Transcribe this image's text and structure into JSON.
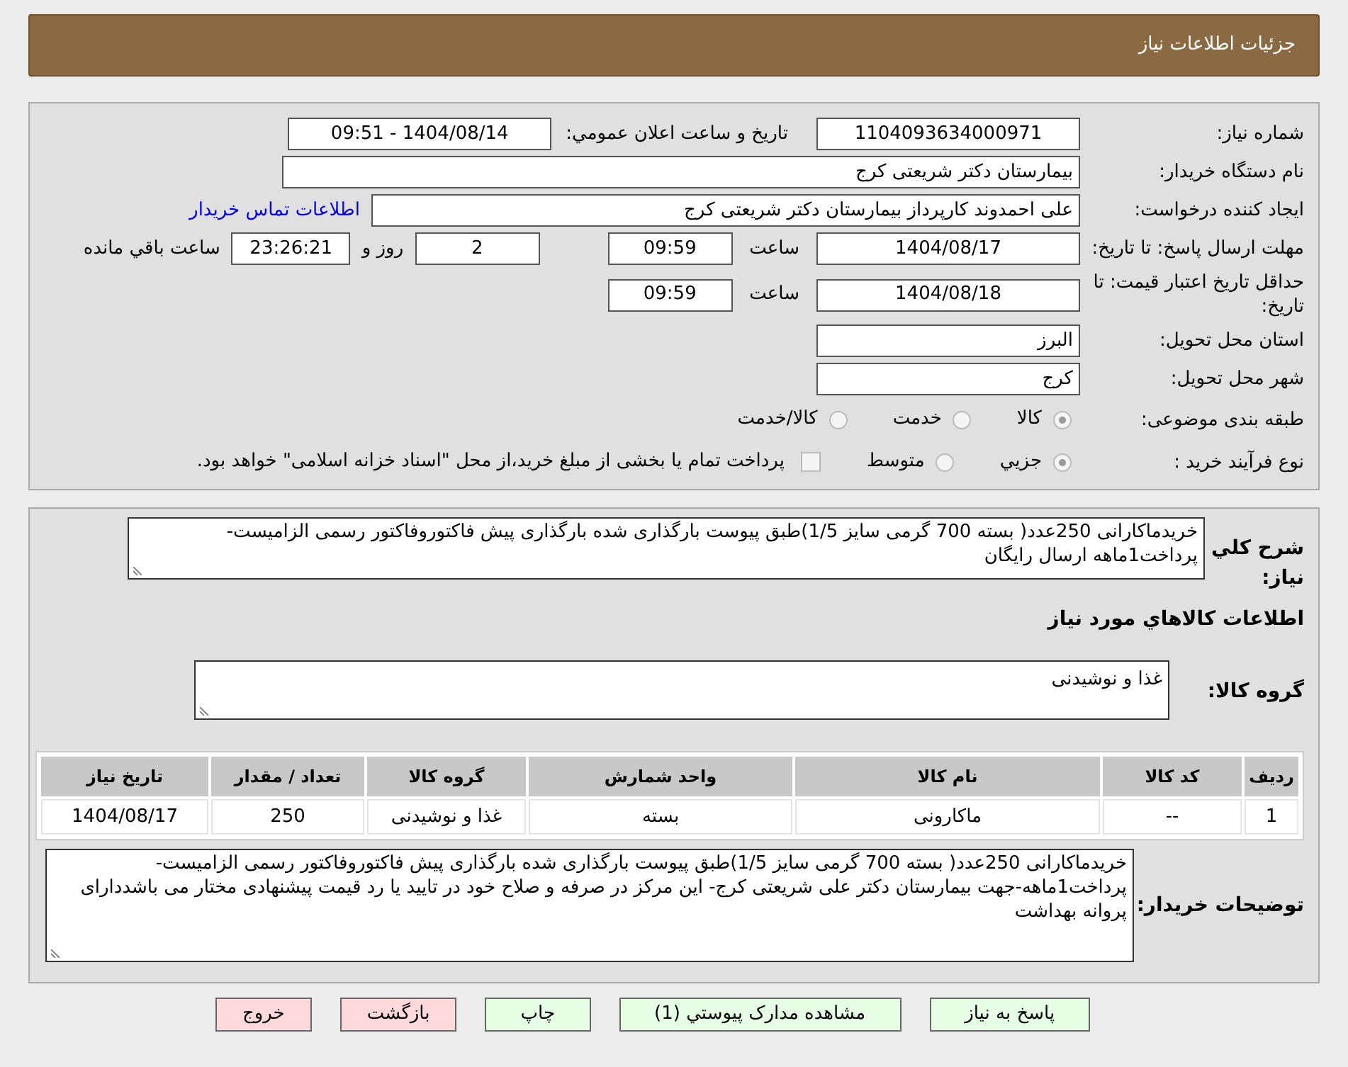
{
  "header": {
    "title": "جزئیات اطلاعات نیاز"
  },
  "need_number": {
    "label": "شماره نیاز:",
    "value": "1104093634000971"
  },
  "announce": {
    "label": "تاریخ و ساعت اعلان عمومي:",
    "value": "1404/08/14 - 09:51"
  },
  "buyer_org": {
    "label": "نام دستگاه خریدار:",
    "value": "بیمارستان دکتر شریعتی کرج"
  },
  "creator": {
    "label": "ایجاد کننده درخواست:",
    "value": "علی احمدوند کارپرداز بیمارستان دکتر شریعتی کرج",
    "link": "اطلاعات تماس خریدار"
  },
  "deadline": {
    "label": "مهلت ارسال پاسخ: تا تاریخ:",
    "date": "1404/08/17",
    "time_label": "ساعت",
    "time": "09:59",
    "days": "2",
    "days_label": "روز و",
    "remaining": "23:26:21",
    "remaining_label": "ساعت باقي مانده"
  },
  "validity": {
    "label": "حداقل تاریخ اعتبار قیمت: تا تاریخ:",
    "date": "1404/08/18",
    "time_label": "ساعت",
    "time": "09:59"
  },
  "province": {
    "label": "استان محل تحویل:",
    "value": "البرز"
  },
  "city": {
    "label": "شهر محل تحویل:",
    "value": "کرج"
  },
  "category": {
    "label": "طبقه بندی موضوعی:",
    "options": [
      {
        "label": "کالا",
        "selected": true
      },
      {
        "label": "خدمت",
        "selected": false
      },
      {
        "label": "کالا/خدمت",
        "selected": false
      }
    ]
  },
  "process": {
    "label": "نوع فرآیند خرید :",
    "options": [
      {
        "label": "جزیي",
        "selected": true
      },
      {
        "label": "متوسط",
        "selected": false
      }
    ],
    "treasury": {
      "label": "پرداخت تمام یا بخشی از مبلغ خرید،از محل \"اسناد خزانه اسلامی\" خواهد بود.",
      "checked": false
    }
  },
  "summary": {
    "label": "شرح کلي نياز:",
    "value": "خریدماکارانی 250عدد( بسته 700 گرمی سایز 1/5)طبق پیوست بارگذاری شده بارگذاری پیش فاکتوروفاکتور رسمی الزامیست- پرداخت1ماهه ارسال رایگان"
  },
  "items_heading": "اطلاعات كالاهاي مورد نياز",
  "goods_group": {
    "label": "گروه کالا:",
    "value": "غذا و نوشیدنی"
  },
  "table": {
    "columns": [
      "رديف",
      "کد کالا",
      "نام کالا",
      "واحد شمارش",
      "گروه کالا",
      "تعداد / مقدار",
      "تاریخ نیاز"
    ],
    "rows": [
      [
        "1",
        "--",
        "ماکارونی",
        "بسته",
        "غذا و نوشیدنی",
        "250",
        "1404/08/17"
      ]
    ]
  },
  "notes": {
    "label": "توضیحات خریدار:",
    "value": "خریدماکارانی 250عدد( بسته 700 گرمی سایز 1/5)طبق پیوست بارگذاری شده بارگذاری پیش فاکتوروفاکتور رسمی الزامیست- پرداخت1ماهه-جهت بیمارستان دکتر علی شریعتی کرج- این مرکز در صرفه و صلاح خود در تایید یا رد قیمت پیشنهادی مختار می باشددارای پروانه بهداشت"
  },
  "buttons": [
    {
      "label": "پاسخ به نیاز",
      "kind": "action"
    },
    {
      "label": "مشاهده مدارک پیوستي (1)",
      "kind": "action"
    },
    {
      "label": "چاپ",
      "kind": "action"
    },
    {
      "label": "بازگشت",
      "kind": "exit"
    },
    {
      "label": "خروج",
      "kind": "exit"
    }
  ]
}
